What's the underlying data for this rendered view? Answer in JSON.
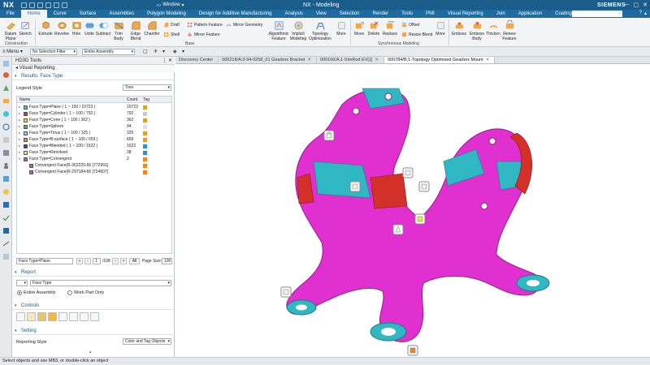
{
  "app": {
    "logo": "NX",
    "title": "NX - Modeling",
    "brand": "SIEMENS",
    "window_menu": "Window",
    "window_controls": [
      "—",
      "▢",
      "✕"
    ]
  },
  "menu_tabs": [
    "File",
    "Home",
    "Curve",
    "Surface",
    "Assemblies",
    "Polygon Modeling",
    "Design for Additive Manufacturing",
    "Analysis",
    "View",
    "Selection",
    "Render",
    "Tools",
    "PMI",
    "Visual Reporting",
    "Join",
    "Application",
    "Coating"
  ],
  "active_tab": "Home",
  "search_placeholder": "",
  "ribbon": {
    "construction": {
      "label": "Construction",
      "buttons": [
        "Datum Plane",
        "Sketch"
      ]
    },
    "base": {
      "label": "Base",
      "buttons": [
        "Extrude",
        "Revolve",
        "Hole",
        "Unite",
        "Subtract",
        "Trim Body",
        "Edge Blend",
        "Chamfer"
      ],
      "small": [
        "Draft",
        "Shell",
        "Pattern Feature",
        "Mirror Feature",
        "Mirror Geometry"
      ],
      "more_buttons": [
        "Algorithmic Feature",
        "Implicit Modeling",
        "Topology Optimization",
        "More"
      ]
    },
    "synchronous": {
      "label": "Synchronous Modeling",
      "buttons": [
        "Move",
        "Delete",
        "Replace",
        "Resize Blend",
        "More"
      ],
      "small": [
        "Offset"
      ]
    },
    "coating": {
      "buttons": [
        "Emboss",
        "Emboss Body",
        "Thicken",
        "Renew Feature"
      ]
    }
  },
  "toolbar": {
    "menu_label": "Menu",
    "selection_filter": "No Selection Filter",
    "scope": "Entire Assembly"
  },
  "panel": {
    "title": "HD3D Tools",
    "subtitle": "Visual Reporting",
    "results_header": "Results: Face Type",
    "legend_style_label": "Legend Style",
    "legend_style_value": "Tree",
    "columns": [
      "Name",
      "Count",
      "Tag"
    ],
    "rows": [
      {
        "name": "Face Type=Plane ( 1 ~ 100 / 10723 )",
        "count": "10723",
        "color": "#3ec7d6",
        "tag": "#d9a13a"
      },
      {
        "name": "Face Type=Cylinder ( 1 ~ 100 / 792 )",
        "count": "792",
        "color": "#d6303a",
        "tag": "#c8c8c8"
      },
      {
        "name": "Face Type=Cone ( 1 ~ 100 / 362 )",
        "count": "362",
        "color": "#e8e02a",
        "tag": "#d9a13a"
      },
      {
        "name": "Face Type=Sphere",
        "count": "94",
        "color": "#3fb94a",
        "tag": "#e0e0e0"
      },
      {
        "name": "Face Type=Torus ( 1 ~ 100 / 325 )",
        "count": "325",
        "color": "#8fd0e8",
        "tag": "#d9a13a"
      },
      {
        "name": "Face Type=B-surface ( 1 ~ 100 / 659 )",
        "count": "659",
        "color": "#e8872a",
        "tag": "#d9a13a"
      },
      {
        "name": "Face Type=Blended ( 1 ~ 100 / 1522 )",
        "count": "1522",
        "color": "#2a3fc8",
        "tag": "#3a8ad9"
      },
      {
        "name": "Face Type=Revolved",
        "count": "38",
        "color": "#f0e86a",
        "tag": "#3a8ad9"
      },
      {
        "name": "Face Type=Convergent",
        "count": "2",
        "color": "#e040d8",
        "tag": "#e8872a"
      }
    ],
    "child_rows": [
      {
        "name": "Convergent Face(R-362225-66 [772991]",
        "color": "#e040d8",
        "tag": "#e8872a"
      },
      {
        "name": "Convergent Face(R-297184-66 [724607]",
        "color": "#e040d8",
        "tag": "#e8872a"
      }
    ],
    "pager": {
      "filter": "Face Type=Plane",
      "page": "1",
      "total": "/108",
      "all_button": "All",
      "page_size_label": "Page Size:",
      "page_size": "100"
    },
    "report": {
      "header": "Report",
      "value": "Face Type",
      "options": [
        "Entire Assembly",
        "Work Part Only"
      ],
      "selected": 0
    },
    "controls": {
      "header": "Controls"
    },
    "setting": {
      "header": "Setting",
      "label": "Reporting Style",
      "value": "Color and Tag Objects"
    }
  },
  "graphics_tabs": [
    {
      "label": "Discovery Center",
      "active": false
    },
    {
      "label": "000218/A;3-94-0258_01 Gearbox Bracket",
      "active": false
    },
    {
      "label": "000166/A;1-SimRod EV[1]",
      "active": false
    },
    {
      "label": "000784/B;1-Topology Optimised Gearbox Mount",
      "active": true
    }
  ],
  "status": "Select objects and use MB3, or double-click an object",
  "colors": {
    "titlebar": "#1a5d8a",
    "menubar": "#1e6ba0",
    "model_magenta": "#e030d0",
    "model_cyan": "#2fb8c4",
    "model_red": "#d4302a"
  }
}
